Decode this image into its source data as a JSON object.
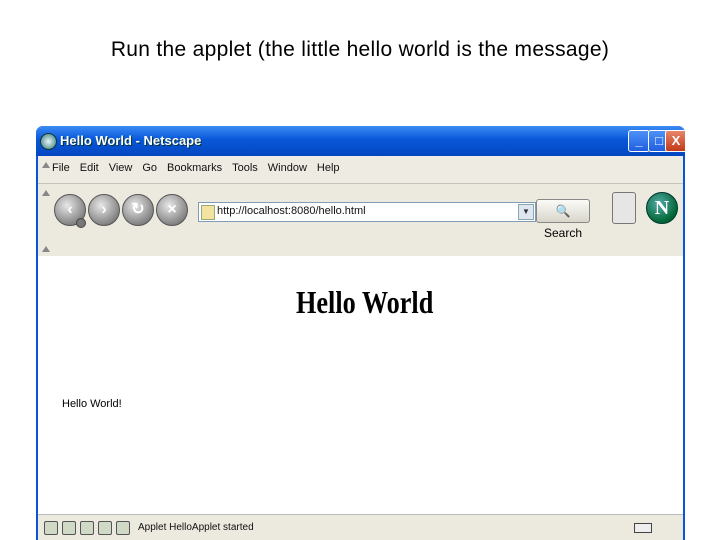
{
  "slide": {
    "title": "Run the applet (the little hello world is the message)"
  },
  "window": {
    "title": "Hello World - Netscape"
  },
  "window_controls": {
    "minimize": "_",
    "maximize": "□",
    "close": "X"
  },
  "menu": [
    "File",
    "Edit",
    "View",
    "Go",
    "Bookmarks",
    "Tools",
    "Window",
    "Help"
  ],
  "nav": {
    "back_icon": "back-arrow-icon",
    "forward_icon": "forward-arrow-icon",
    "reload_icon": "reload-icon",
    "stop_icon": "stop-icon",
    "url": "http://localhost:8080/hello.html",
    "search_label": "Search",
    "logo_letter": "N"
  },
  "page": {
    "heading": "Hello World",
    "applet_message": "Hello World!"
  },
  "status": {
    "text": "Applet HelloApplet started"
  },
  "colors": {
    "titlebar": "#0a54d8",
    "chrome": "#ece9df"
  }
}
